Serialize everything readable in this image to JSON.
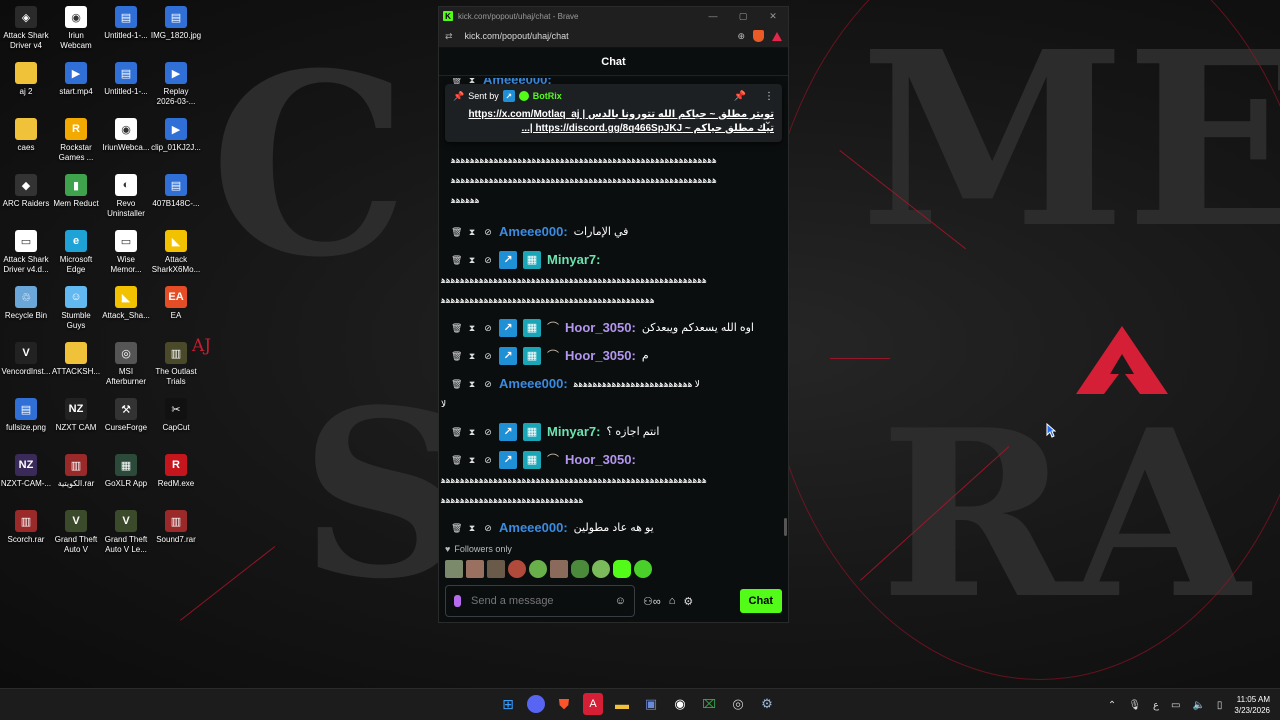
{
  "desktop": {
    "icons": [
      {
        "label": "Attack Shark\nDriver v4",
        "color": "#2a2a2a",
        "glyph": "◈"
      },
      {
        "label": "Iriun\nWebcam",
        "color": "#ffffff",
        "glyph": "◉"
      },
      {
        "label": "Untitled-1-...",
        "color": "#2f6fd6",
        "glyph": "▤"
      },
      {
        "label": "IMG_1820.jpg",
        "color": "#2f6fd6",
        "glyph": "▤"
      },
      {
        "label": "aj 2",
        "color": "#f0c23a",
        "glyph": ""
      },
      {
        "label": "start.mp4",
        "color": "#2f6fd6",
        "glyph": "▶"
      },
      {
        "label": "Untitled-1-...",
        "color": "#2f6fd6",
        "glyph": "▤"
      },
      {
        "label": "Replay\n2026-03-...",
        "color": "#2f6fd6",
        "glyph": "▶"
      },
      {
        "label": "caes",
        "color": "#f0c23a",
        "glyph": ""
      },
      {
        "label": "Rockstar\nGames ...",
        "color": "#f2a900",
        "glyph": "R"
      },
      {
        "label": "IriunWebca...",
        "color": "#ffffff",
        "glyph": "◉"
      },
      {
        "label": "clip_01KJ2J...",
        "color": "#2f6fd6",
        "glyph": "▶"
      },
      {
        "label": "ARC Raiders",
        "color": "#333333",
        "glyph": "◆"
      },
      {
        "label": "Mem Reduct",
        "color": "#3fa34d",
        "glyph": "▮"
      },
      {
        "label": "Revo\nUninstaller",
        "color": "#ffffff",
        "glyph": "◐"
      },
      {
        "label": "407B148C-...",
        "color": "#2f6fd6",
        "glyph": "▤"
      },
      {
        "label": "Attack Shark\nDriver v4.d...",
        "color": "#ffffff",
        "glyph": "▭"
      },
      {
        "label": "Microsoft\nEdge",
        "color": "#1fa3d6",
        "glyph": "e"
      },
      {
        "label": "Wise\nMemor...",
        "color": "#ffffff",
        "glyph": "▭"
      },
      {
        "label": "Attack\nSharkX6Mo...",
        "color": "#f2c200",
        "glyph": "◣"
      },
      {
        "label": "Recycle Bin",
        "color": "#6aa6d8",
        "glyph": "♲"
      },
      {
        "label": "Stumble\nGuys",
        "color": "#62b8f0",
        "glyph": "☺"
      },
      {
        "label": "Attack_Sha...",
        "color": "#f2c200",
        "glyph": "◣"
      },
      {
        "label": "EA",
        "color": "#e44d26",
        "glyph": "EA"
      },
      {
        "label": "VencordInst...",
        "color": "#222222",
        "glyph": "V"
      },
      {
        "label": "ATTACKSH...",
        "color": "#f0c23a",
        "glyph": ""
      },
      {
        "label": "MSI\nAfterburner",
        "color": "#555555",
        "glyph": "◎"
      },
      {
        "label": "The Outlast\nTrials",
        "color": "#4a4a2a",
        "glyph": "▥"
      },
      {
        "label": "fullsize.png",
        "color": "#2f6fd6",
        "glyph": "▤"
      },
      {
        "label": "NZXT CAM",
        "color": "#222222",
        "glyph": "NZ"
      },
      {
        "label": "CurseForge",
        "color": "#333333",
        "glyph": "⚒"
      },
      {
        "label": "CapCut",
        "color": "#111111",
        "glyph": "✂"
      },
      {
        "label": "NZXT-CAM-...",
        "color": "#3a2a5a",
        "glyph": "NZ"
      },
      {
        "label": "الكويتية.rar",
        "color": "#9a2a2a",
        "glyph": "▥"
      },
      {
        "label": "GoXLR App",
        "color": "#2b4a3a",
        "glyph": "▦"
      },
      {
        "label": "RedM.exe",
        "color": "#c4161c",
        "glyph": "R"
      },
      {
        "label": "Scorch.rar",
        "color": "#9a2a2a",
        "glyph": "▥"
      },
      {
        "label": "Grand Theft\nAuto V",
        "color": "#3a4a2a",
        "glyph": "V"
      },
      {
        "label": "Grand Theft\nAuto V Le...",
        "color": "#3a4a2a",
        "glyph": "V"
      },
      {
        "label": "Sound7.rar",
        "color": "#9a2a2a",
        "glyph": "▥"
      }
    ],
    "wallpaper_text": "AJ"
  },
  "browser": {
    "tab_title": "kick.com/popout/uhaj/chat - Brave",
    "url": "kick.com/popout/uhaj/chat",
    "brand_color": "#53fc18"
  },
  "chat": {
    "title": "Chat",
    "pinned": {
      "sent_by": "Sent by",
      "bot_name": "BotRix",
      "line1": "تويتر مطلق ~ حياكم الله تتورونا بالدس | https://x.com/Motlaq_aj",
      "line2": "تيك مطلق حياكم ~ https://discord.gg/8q466SpJKJ |..."
    },
    "messages": [
      {
        "user": "",
        "text": "ﻫﻫﻫﻫﻫﻫﻫﻫﻫﻫﻫﻫﻫﻫﻫﻫﻫﻫﻫﻫﻫﻫﻫﻫﻫﻫﻫﻫﻫﻫﻫﻫﻫﻫﻫﻫﻫﻫﻫﻫﻫﻫﻫﻫﻫﻫﻫﻫﻫﻫﻫﻫﻫﻫﻫﻫ\nﻫﻫﻫﻫﻫﻫﻫﻫﻫﻫﻫﻫﻫﻫﻫﻫﻫﻫﻫﻫﻫﻫﻫﻫﻫﻫﻫﻫﻫﻫﻫﻫﻫﻫﻫﻫﻫﻫﻫﻫﻫﻫﻫﻫﻫﻫﻫﻫﻫﻫﻫﻫﻫﻫﻫﻫ\nﻫﻫﻫﻫﻫﻫ"
      },
      {
        "user": "Ameee000:",
        "text": "في الإمارات"
      },
      {
        "user": "Minyar7:",
        "text": "ﻫﻫﻫﻫﻫﻫﻫﻫﻫﻫﻫﻫﻫﻫﻫﻫﻫﻫﻫﻫﻫﻫﻫﻫﻫﻫﻫﻫﻫﻫﻫﻫﻫﻫﻫﻫﻫﻫﻫﻫﻫﻫﻫﻫﻫﻫﻫﻫﻫﻫﻫﻫﻫﻫﻫﻫ\nﻫﻫﻫﻫﻫﻫﻫﻫﻫﻫﻫﻫﻫﻫﻫﻫﻫﻫﻫﻫﻫﻫﻫﻫﻫﻫﻫﻫﻫﻫﻫﻫﻫﻫﻫﻫﻫﻫﻫﻫﻫﻫﻫﻫﻫ"
      },
      {
        "user": "Hoor_3050:",
        "text": "اوه الله يسعدكم ويبعدكن"
      },
      {
        "user": "Hoor_3050:",
        "text": "م"
      },
      {
        "user": "Ameee000:",
        "text": "لا ﻫﻫﻫﻫﻫﻫﻫﻫﻫﻫﻫﻫﻫﻫﻫﻫﻫﻫﻫﻫﻫﻫﻫﻫﻫ",
        "text2": "لا"
      },
      {
        "user": "Minyar7:",
        "text": "انتم اجازه ؟"
      },
      {
        "user": "Hoor_3050:",
        "text": "ﻫﻫﻫﻫﻫﻫﻫﻫﻫﻫﻫﻫﻫﻫﻫﻫﻫﻫﻫﻫﻫﻫﻫﻫﻫﻫﻫﻫﻫﻫﻫﻫﻫﻫﻫﻫﻫﻫﻫﻫﻫﻫﻫﻫﻫﻫﻫﻫﻫﻫﻫﻫﻫﻫﻫﻫ\nﻫﻫﻫﻫﻫﻫﻫﻫﻫﻫﻫﻫﻫﻫﻫﻫﻫﻫﻫﻫﻫﻫﻫﻫﻫﻫﻫﻫﻫﻫ"
      },
      {
        "user": "Ameee000:",
        "text": "يو هه عاد مطولين"
      }
    ],
    "followers_only": "Followers only",
    "input_placeholder": "Send a message",
    "send_label": "Chat"
  },
  "taskbar": {
    "time": "11:05 AM",
    "date": "3/23/2026",
    "lang": "ع"
  }
}
